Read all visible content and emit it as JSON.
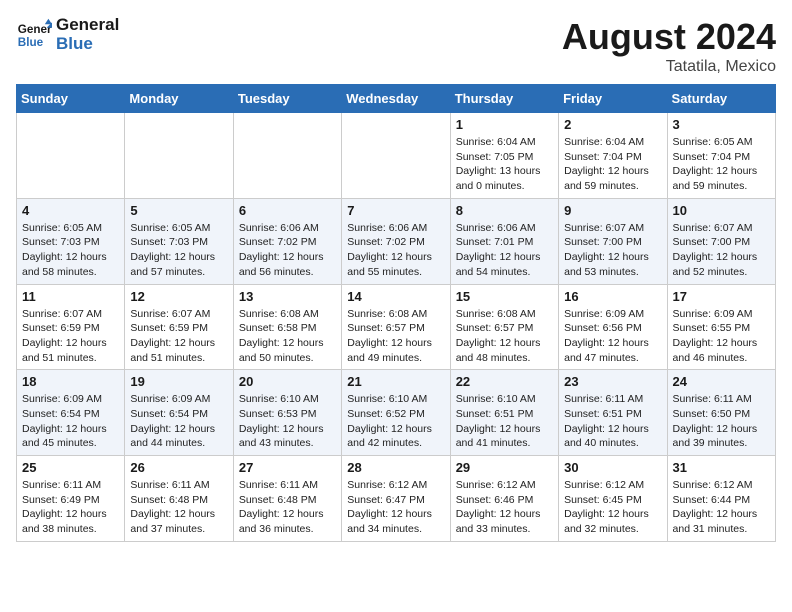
{
  "header": {
    "logo_line1": "General",
    "logo_line2": "Blue",
    "month_year": "August 2024",
    "location": "Tatatila, Mexico"
  },
  "days_of_week": [
    "Sunday",
    "Monday",
    "Tuesday",
    "Wednesday",
    "Thursday",
    "Friday",
    "Saturday"
  ],
  "weeks": [
    [
      {
        "day": "",
        "info": ""
      },
      {
        "day": "",
        "info": ""
      },
      {
        "day": "",
        "info": ""
      },
      {
        "day": "",
        "info": ""
      },
      {
        "day": "1",
        "info": "Sunrise: 6:04 AM\nSunset: 7:05 PM\nDaylight: 13 hours\nand 0 minutes."
      },
      {
        "day": "2",
        "info": "Sunrise: 6:04 AM\nSunset: 7:04 PM\nDaylight: 12 hours\nand 59 minutes."
      },
      {
        "day": "3",
        "info": "Sunrise: 6:05 AM\nSunset: 7:04 PM\nDaylight: 12 hours\nand 59 minutes."
      }
    ],
    [
      {
        "day": "4",
        "info": "Sunrise: 6:05 AM\nSunset: 7:03 PM\nDaylight: 12 hours\nand 58 minutes."
      },
      {
        "day": "5",
        "info": "Sunrise: 6:05 AM\nSunset: 7:03 PM\nDaylight: 12 hours\nand 57 minutes."
      },
      {
        "day": "6",
        "info": "Sunrise: 6:06 AM\nSunset: 7:02 PM\nDaylight: 12 hours\nand 56 minutes."
      },
      {
        "day": "7",
        "info": "Sunrise: 6:06 AM\nSunset: 7:02 PM\nDaylight: 12 hours\nand 55 minutes."
      },
      {
        "day": "8",
        "info": "Sunrise: 6:06 AM\nSunset: 7:01 PM\nDaylight: 12 hours\nand 54 minutes."
      },
      {
        "day": "9",
        "info": "Sunrise: 6:07 AM\nSunset: 7:00 PM\nDaylight: 12 hours\nand 53 minutes."
      },
      {
        "day": "10",
        "info": "Sunrise: 6:07 AM\nSunset: 7:00 PM\nDaylight: 12 hours\nand 52 minutes."
      }
    ],
    [
      {
        "day": "11",
        "info": "Sunrise: 6:07 AM\nSunset: 6:59 PM\nDaylight: 12 hours\nand 51 minutes."
      },
      {
        "day": "12",
        "info": "Sunrise: 6:07 AM\nSunset: 6:59 PM\nDaylight: 12 hours\nand 51 minutes."
      },
      {
        "day": "13",
        "info": "Sunrise: 6:08 AM\nSunset: 6:58 PM\nDaylight: 12 hours\nand 50 minutes."
      },
      {
        "day": "14",
        "info": "Sunrise: 6:08 AM\nSunset: 6:57 PM\nDaylight: 12 hours\nand 49 minutes."
      },
      {
        "day": "15",
        "info": "Sunrise: 6:08 AM\nSunset: 6:57 PM\nDaylight: 12 hours\nand 48 minutes."
      },
      {
        "day": "16",
        "info": "Sunrise: 6:09 AM\nSunset: 6:56 PM\nDaylight: 12 hours\nand 47 minutes."
      },
      {
        "day": "17",
        "info": "Sunrise: 6:09 AM\nSunset: 6:55 PM\nDaylight: 12 hours\nand 46 minutes."
      }
    ],
    [
      {
        "day": "18",
        "info": "Sunrise: 6:09 AM\nSunset: 6:54 PM\nDaylight: 12 hours\nand 45 minutes."
      },
      {
        "day": "19",
        "info": "Sunrise: 6:09 AM\nSunset: 6:54 PM\nDaylight: 12 hours\nand 44 minutes."
      },
      {
        "day": "20",
        "info": "Sunrise: 6:10 AM\nSunset: 6:53 PM\nDaylight: 12 hours\nand 43 minutes."
      },
      {
        "day": "21",
        "info": "Sunrise: 6:10 AM\nSunset: 6:52 PM\nDaylight: 12 hours\nand 42 minutes."
      },
      {
        "day": "22",
        "info": "Sunrise: 6:10 AM\nSunset: 6:51 PM\nDaylight: 12 hours\nand 41 minutes."
      },
      {
        "day": "23",
        "info": "Sunrise: 6:11 AM\nSunset: 6:51 PM\nDaylight: 12 hours\nand 40 minutes."
      },
      {
        "day": "24",
        "info": "Sunrise: 6:11 AM\nSunset: 6:50 PM\nDaylight: 12 hours\nand 39 minutes."
      }
    ],
    [
      {
        "day": "25",
        "info": "Sunrise: 6:11 AM\nSunset: 6:49 PM\nDaylight: 12 hours\nand 38 minutes."
      },
      {
        "day": "26",
        "info": "Sunrise: 6:11 AM\nSunset: 6:48 PM\nDaylight: 12 hours\nand 37 minutes."
      },
      {
        "day": "27",
        "info": "Sunrise: 6:11 AM\nSunset: 6:48 PM\nDaylight: 12 hours\nand 36 minutes."
      },
      {
        "day": "28",
        "info": "Sunrise: 6:12 AM\nSunset: 6:47 PM\nDaylight: 12 hours\nand 34 minutes."
      },
      {
        "day": "29",
        "info": "Sunrise: 6:12 AM\nSunset: 6:46 PM\nDaylight: 12 hours\nand 33 minutes."
      },
      {
        "day": "30",
        "info": "Sunrise: 6:12 AM\nSunset: 6:45 PM\nDaylight: 12 hours\nand 32 minutes."
      },
      {
        "day": "31",
        "info": "Sunrise: 6:12 AM\nSunset: 6:44 PM\nDaylight: 12 hours\nand 31 minutes."
      }
    ]
  ]
}
